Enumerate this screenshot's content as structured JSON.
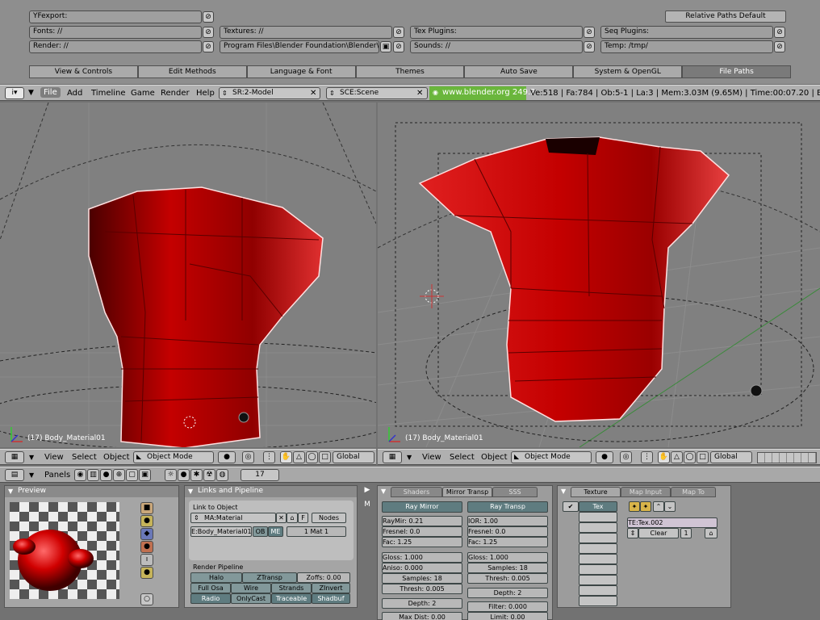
{
  "prefs": {
    "yf_label": "YFexport:",
    "fonts_label": "Fonts: //",
    "render_label": "Render: //",
    "textures_label": "Textures: //",
    "program_path": "Program Files\\Blender Foundation\\Blender\\",
    "tex_plugins_label": "Tex Plugins:",
    "sounds_label": "Sounds: //",
    "seq_plugins_label": "Seq Plugins:",
    "temp_label": "Temp: /tmp/",
    "relative_paths_button": "Relative Paths Default",
    "tabs": [
      "View & Controls",
      "Edit Methods",
      "Language & Font",
      "Themes",
      "Auto Save",
      "System & OpenGL",
      "File Paths"
    ]
  },
  "header": {
    "menus": [
      "File",
      "Add",
      "Timeline",
      "Game",
      "Render",
      "Help"
    ],
    "screen_field": "SR:2-Model",
    "scene_field": "SCE:Scene",
    "website": "www.blender.org 249.2",
    "stats": "Ve:518 | Fa:784 | Ob:5-1 | La:3  | Mem:3.03M (9.65M) | Time:00:07.20 | Body_"
  },
  "viewport_left": {
    "label": "(17) Body_Material01"
  },
  "viewport_right": {
    "label": "(17) Body_Material01"
  },
  "vp_header": {
    "menus": [
      "View",
      "Select",
      "Object"
    ],
    "mode": "Object Mode",
    "orientation": "Global"
  },
  "buttons_header": {
    "panels_label": "Panels",
    "frame": "17"
  },
  "preview": {
    "title": "Preview"
  },
  "links": {
    "title": "Links and Pipeline",
    "link_to_object": "Link to Object",
    "material": "MA:Material",
    "f_button": "F",
    "nodes_button": "Nodes",
    "object_field": "E:Body_Material01",
    "ob_button": "OB",
    "me_button": "ME",
    "mat_slot": "1 Mat 1",
    "render_pipeline": "Render Pipeline",
    "pipeline_rows": [
      [
        "Halo",
        "ZTransp",
        "Zoffs: 0.00"
      ],
      [
        "Full Osa",
        "Wire",
        "Strands",
        "ZInvert"
      ],
      [
        "Radio",
        "OnlyCast",
        "Traceable",
        "Shadbuf"
      ]
    ]
  },
  "mirror": {
    "tabs": [
      "Shaders",
      "Mirror Transp",
      "SSS"
    ],
    "ray_mirror": "Ray Mirror",
    "ray_transp": "Ray Transp",
    "left": [
      "RayMir: 0.21",
      "Fresnel: 0.0",
      "Fac: 1.25",
      "Gloss: 1.000",
      "Aniso: 0.000",
      "Samples: 18",
      "Thresh: 0.005",
      "Depth: 2",
      "Max Dist: 0.00"
    ],
    "right": [
      "IOR: 1.00",
      "Fresnel: 0.0",
      "Fac: 1.25",
      "Gloss: 1.000",
      "Samples: 18",
      "Thresh: 0.005",
      "Depth: 2",
      "Filter: 0.000",
      "Limit: 0.00"
    ]
  },
  "texture": {
    "tabs": [
      "Texture",
      "Map Input",
      "Map To"
    ],
    "tex_slot": "Tex",
    "tex_name": "TE:Tex.002",
    "clear_button": "Clear",
    "users": "1"
  }
}
